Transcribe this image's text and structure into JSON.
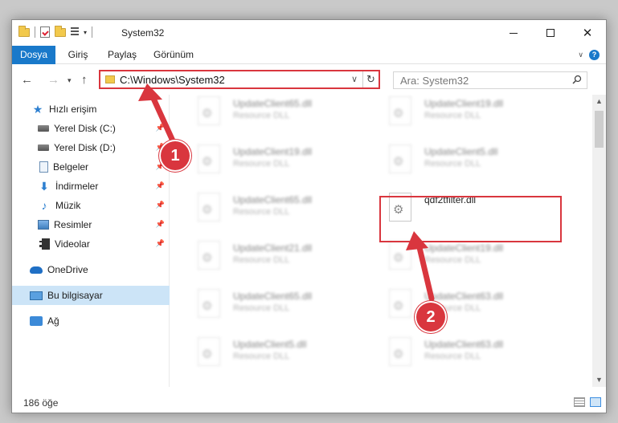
{
  "window": {
    "title": "System32"
  },
  "ribbon": {
    "tabs": [
      "Dosya",
      "Giriş",
      "Paylaş",
      "Görünüm"
    ],
    "help": "?"
  },
  "address": {
    "path": "C:\\Windows\\System32",
    "search_placeholder": "Ara: System32"
  },
  "sidebar": {
    "items": [
      {
        "label": "Hızlı erişim",
        "icon": "star-icon"
      },
      {
        "label": "Yerel Disk (C:)",
        "icon": "drive-icon",
        "pinned": true
      },
      {
        "label": "Yerel Disk (D:)",
        "icon": "drive-icon",
        "pinned": true
      },
      {
        "label": "Belgeler",
        "icon": "document-icon",
        "pinned": true
      },
      {
        "label": "İndirmeler",
        "icon": "download-icon",
        "pinned": true
      },
      {
        "label": "Müzik",
        "icon": "music-icon",
        "pinned": true
      },
      {
        "label": "Resimler",
        "icon": "pictures-icon",
        "pinned": true
      },
      {
        "label": "Videolar",
        "icon": "videos-icon",
        "pinned": true
      },
      {
        "label": "OneDrive",
        "icon": "cloud-icon"
      },
      {
        "label": "Bu bilgisayar",
        "icon": "computer-icon",
        "selected": true
      },
      {
        "label": "Ağ",
        "icon": "network-icon"
      }
    ]
  },
  "files": [
    {
      "name": "UpdateClient65.dll",
      "desc": "Resource DLL"
    },
    {
      "name": "UpdateClient19.dll",
      "desc": "Resource DLL"
    },
    {
      "name": "UpdateClient19.dll",
      "desc": "Resource DLL"
    },
    {
      "name": "UpdateClient5.dll",
      "desc": "Resource DLL"
    },
    {
      "name": "UpdateClient65.dll",
      "desc": "Resource DLL"
    },
    {
      "name": "qdf2tfilter.dll",
      "desc": ""
    },
    {
      "name": "UpdateClient21.dll",
      "desc": "Resource DLL"
    },
    {
      "name": "UpdateClient19.dll",
      "desc": "Resource DLL"
    },
    {
      "name": "UpdateClient65.dll",
      "desc": "Resource DLL"
    },
    {
      "name": "UpdateClient63.dll",
      "desc": "Resource DLL"
    },
    {
      "name": "UpdateClient5.dll",
      "desc": "Resource DLL"
    },
    {
      "name": "UpdateClient63.dll",
      "desc": "Resource DLL"
    }
  ],
  "status": {
    "count": "186 öğe"
  },
  "annotations": {
    "step1": "1",
    "step2": "2",
    "color": "#d9363e"
  }
}
